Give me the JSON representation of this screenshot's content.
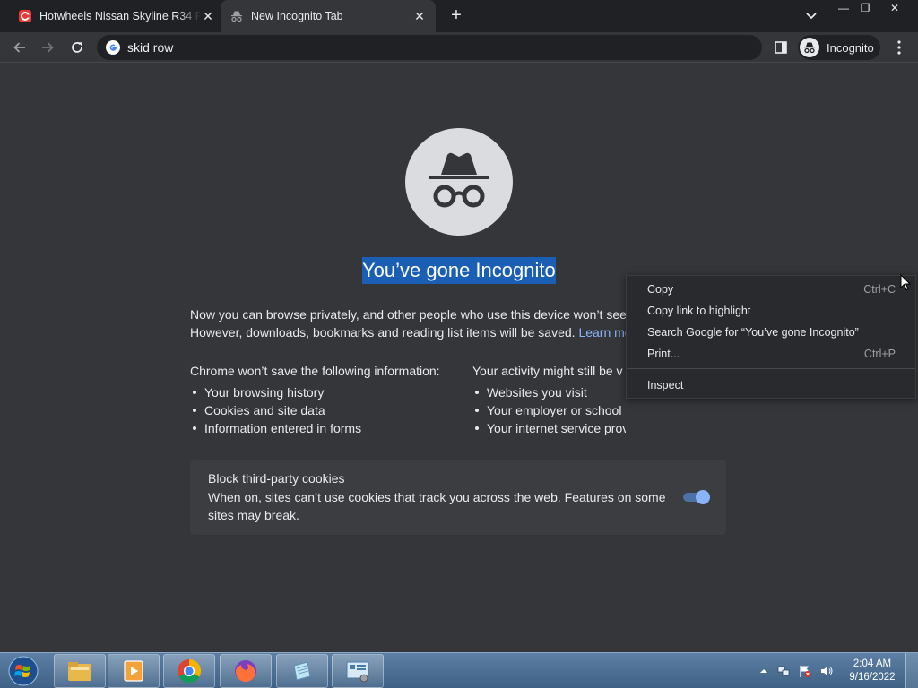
{
  "colors": {
    "tab_strip": "#202124",
    "toolbar": "#35363a",
    "page_background": "#35363a",
    "heading_highlight": "#1a5fb4",
    "link": "#8ab4f8",
    "context_menu": "#292a2d",
    "taskbar": "#4a6d92"
  },
  "tabs": [
    {
      "title": "Hotwheels Nissan Skyline R34 Fr",
      "favicon": "red-c-app-icon",
      "close": "✕",
      "active": false
    },
    {
      "title": "New Incognito Tab",
      "favicon": "incognito-icon",
      "close": "✕",
      "active": true
    }
  ],
  "tabstrip": {
    "new_tab": "+",
    "tab_search_icon": "chevron-down-icon"
  },
  "window_controls": {
    "minimize": "—",
    "maximize": "❐",
    "close": "✕"
  },
  "toolbar": {
    "back_icon": "back-arrow-icon",
    "forward_icon": "forward-arrow-icon",
    "reload_icon": "reload-icon",
    "omnibox_icon": "google-g-icon",
    "omnibox_value": "skid row",
    "side_panel_icon": "side-panel-icon",
    "incognito_label": "Incognito",
    "menu_icon": "kebab-menu-icon"
  },
  "page": {
    "heading": "You’ve gone Incognito",
    "intro_line_1": "Now you can browse privately, and other people who use this device won’t see",
    "intro_line_2": "However, downloads, bookmarks and reading list items will be saved.",
    "learn_more": "Learn more",
    "left_title": "Chrome won’t save the following information:",
    "left_items": [
      "Your browsing history",
      "Cookies and site data",
      "Information entered in forms"
    ],
    "right_title_visible": "Your activity might still be v",
    "right_items": [
      "Websites you visit",
      "Your employer or school",
      "Your internet service provider"
    ],
    "cookie_title": "Block third-party cookies",
    "cookie_desc": "When on, sites can’t use cookies that track you across the web. Features on some sites may break.",
    "cookie_toggle_on": true
  },
  "context_menu": {
    "items": [
      {
        "label": "Copy",
        "shortcut": "Ctrl+C"
      },
      {
        "label": "Copy link to highlight",
        "shortcut": ""
      },
      {
        "label": "Search Google for “You’ve gone Incognito”",
        "shortcut": ""
      },
      {
        "label": "Print...",
        "shortcut": "Ctrl+P"
      },
      {
        "label": "Inspect",
        "shortcut": ""
      }
    ]
  },
  "taskbar": {
    "start_icon": "windows-start-orb-icon",
    "pinned": [
      {
        "name": "file-explorer-icon"
      },
      {
        "name": "media-player-icon"
      },
      {
        "name": "chrome-icon"
      },
      {
        "name": "firefox-icon"
      },
      {
        "name": "notepad-icon"
      },
      {
        "name": "control-panel-icon"
      }
    ],
    "tray_icons": [
      "show-hidden-icons-arrow",
      "network-icon",
      "action-center-flag-icon",
      "volume-icon"
    ],
    "clock_time": "2:04 AM",
    "clock_date": "9/16/2022"
  }
}
